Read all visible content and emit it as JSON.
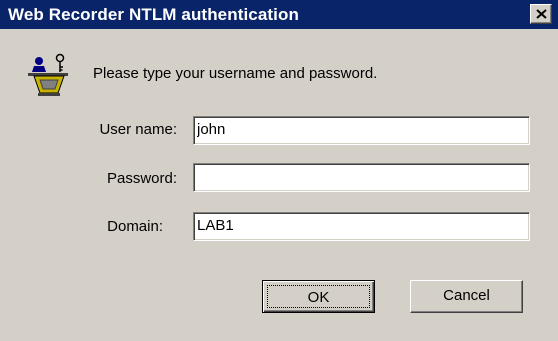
{
  "window": {
    "title": "Web Recorder NTLM authentication",
    "close_glyph": "close-icon"
  },
  "prompt": "Please type your username and password.",
  "fields": {
    "username": {
      "label": "User name:",
      "value": "john"
    },
    "password": {
      "label": "Password:",
      "value": ""
    },
    "domain": {
      "label": "Domain:",
      "value": "LAB1"
    }
  },
  "buttons": {
    "ok": "OK",
    "cancel": "Cancel"
  },
  "colors": {
    "titlebar": "#0a246a",
    "face": "#d4d0c8"
  }
}
